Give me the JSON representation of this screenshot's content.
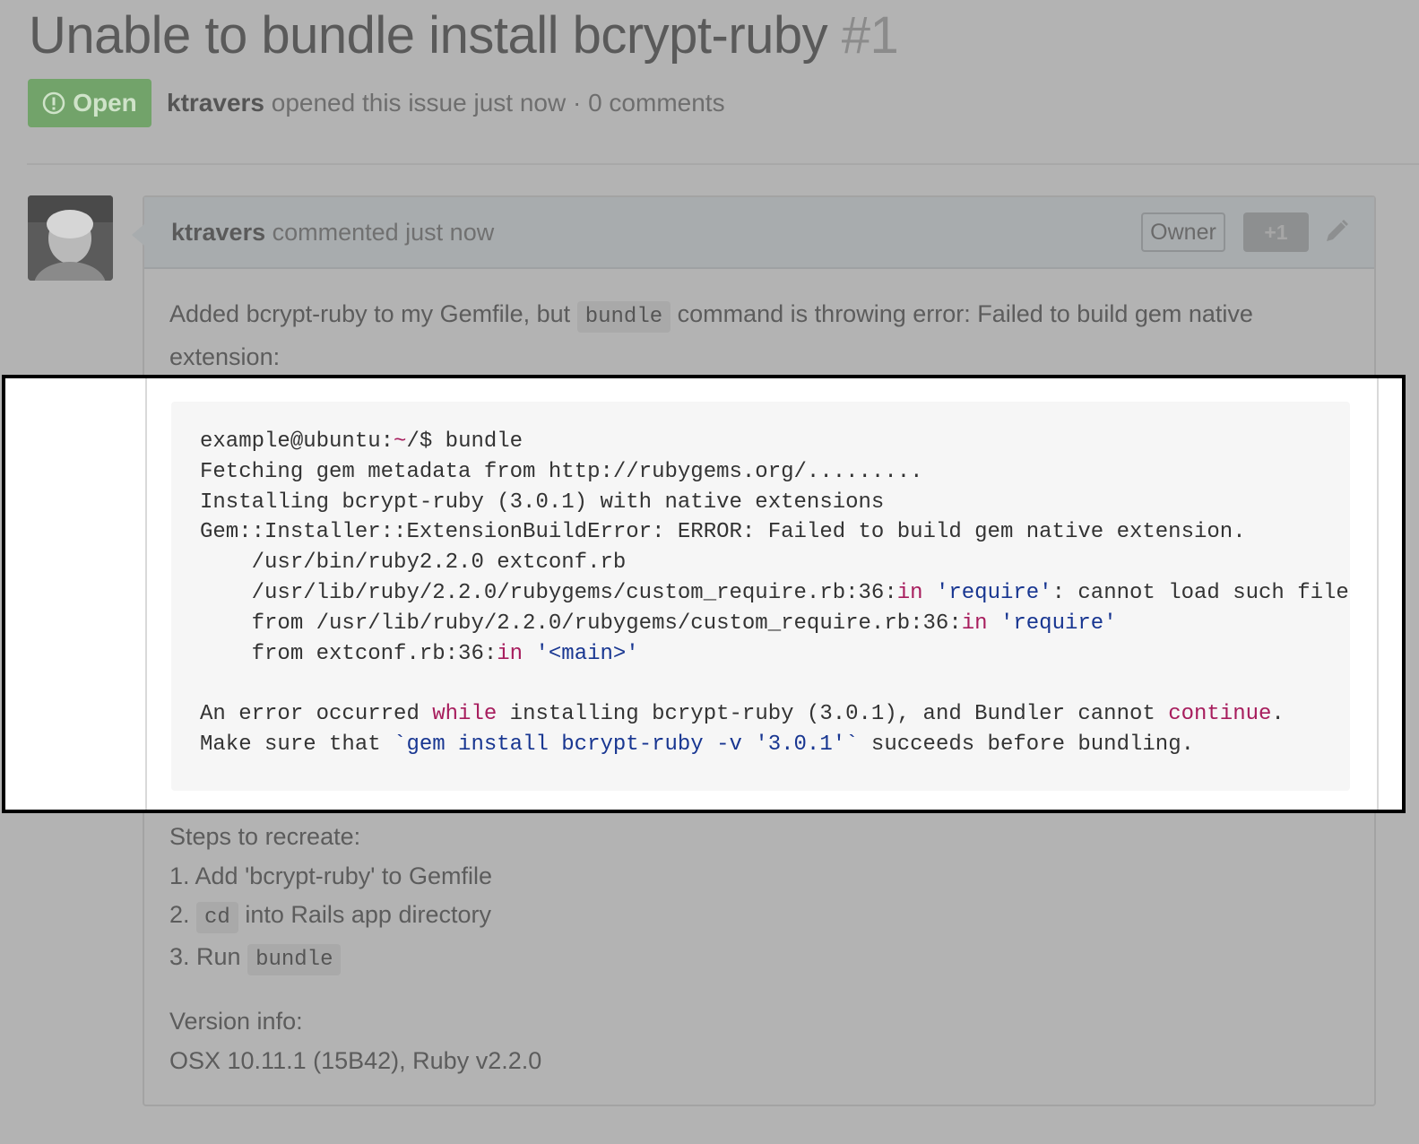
{
  "issue": {
    "title": "Unable to bundle install bcrypt-ruby",
    "number": "#1",
    "status_label": "Open",
    "author": "ktravers",
    "meta_text": " opened this issue just now · 0 comments"
  },
  "comment": {
    "author": "ktravers",
    "header_text": " commented just now",
    "owner_label": "Owner",
    "plus_label": "+1",
    "intro_1": "Added bcrypt-ruby to my Gemfile, but ",
    "intro_code": "bundle",
    "intro_2": " command is throwing error: Failed to build gem native",
    "intro_3": "extension:",
    "code_lines": [
      [
        {
          "t": "example@ubuntu:"
        },
        {
          "t": "~",
          "c": "kw"
        },
        {
          "t": "/$ bundle"
        }
      ],
      [
        {
          "t": "Fetching gem metadata from http://rubygems.org/........."
        }
      ],
      [
        {
          "t": "Installing bcrypt-ruby (3.0.1) with native extensions"
        }
      ],
      [
        {
          "t": "Gem::Installer::ExtensionBuildError: ERROR: Failed to build gem native extension."
        }
      ],
      [
        {
          "t": "    /usr/bin/ruby2.2.0 extconf.rb"
        }
      ],
      [
        {
          "t": "    /usr/lib/ruby/2.2.0/rubygems/custom_require.rb:36:"
        },
        {
          "t": "in",
          "c": "kw"
        },
        {
          "t": " "
        },
        {
          "t": "'require'",
          "c": "st"
        },
        {
          "t": ": cannot load such file -- mkmf (LoadError)"
        }
      ],
      [
        {
          "t": "    from /usr/lib/ruby/2.2.0/rubygems/custom_require.rb:36:"
        },
        {
          "t": "in",
          "c": "kw"
        },
        {
          "t": " "
        },
        {
          "t": "'require'",
          "c": "st"
        }
      ],
      [
        {
          "t": "    from extconf.rb:36:"
        },
        {
          "t": "in",
          "c": "kw"
        },
        {
          "t": " "
        },
        {
          "t": "'<main>'",
          "c": "st"
        }
      ],
      [
        {
          "t": ""
        }
      ],
      [
        {
          "t": "An error occurred "
        },
        {
          "t": "while",
          "c": "kw"
        },
        {
          "t": " installing bcrypt-ruby (3.0.1), and Bundler cannot "
        },
        {
          "t": "continue",
          "c": "kw"
        },
        {
          "t": "."
        }
      ],
      [
        {
          "t": "Make sure that "
        },
        {
          "t": "`gem install bcrypt-ruby -v '3.0.1'`",
          "c": "st"
        },
        {
          "t": " succeeds before bundling."
        }
      ]
    ],
    "steps_heading": "Steps to recreate:",
    "step1": "1. Add 'bcrypt-ruby' to Gemfile",
    "step2_prefix": "2. ",
    "step2_code": "cd",
    "step2_suffix": " into Rails app directory",
    "step3_prefix": "3. Run ",
    "step3_code": "bundle",
    "version_heading": "Version info:",
    "version_text": "OSX 10.11.1 (15B42), Ruby v2.2.0"
  },
  "colors": {
    "open_badge": "#72a36a",
    "keyword": "#a71d5d",
    "string": "#183691"
  },
  "icons": [
    "issue-opened-icon",
    "pencil-icon"
  ]
}
